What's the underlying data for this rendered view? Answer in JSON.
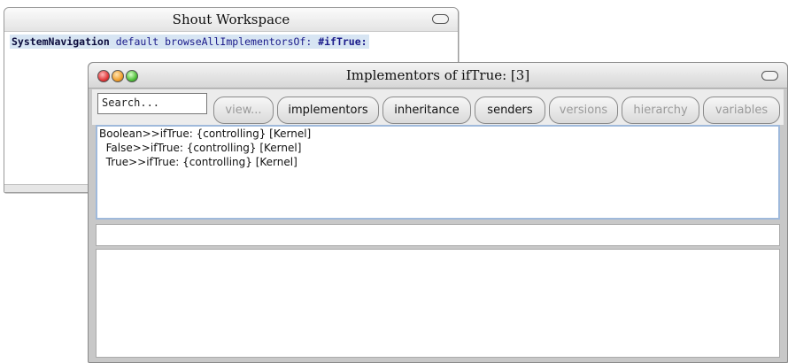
{
  "workspace": {
    "title": "Shout Workspace",
    "code": {
      "receiver": "SystemNavigation",
      "message": " default browseAllImplementorsOf: ",
      "symbol": "#ifTrue:"
    }
  },
  "browser": {
    "title": "Implementors of ifTrue: [3]",
    "search_placeholder": "Search...",
    "buttons": {
      "view": "view...",
      "implementors": "implementors",
      "inheritance": "inheritance",
      "senders": "senders",
      "versions": "versions",
      "hierarchy": "hierarchy",
      "variables": "variables"
    },
    "methods": [
      "Boolean>>ifTrue: {controlling} [Kernel]",
      "  False>>ifTrue: {controlling} [Kernel]",
      "  True>>ifTrue: {controlling} [Kernel]"
    ]
  },
  "colors": {
    "selection": "#d7e5f3",
    "list_border": "#9fb9db",
    "window_frame": "#c8c8c8"
  }
}
